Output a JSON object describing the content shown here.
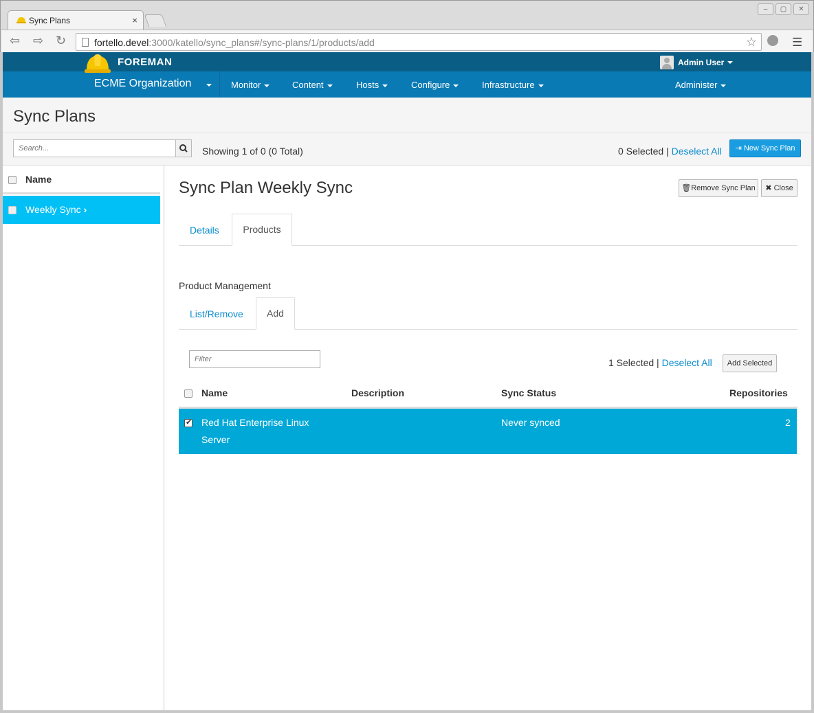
{
  "browser": {
    "tab_title": "Sync Plans",
    "tab_close": "×",
    "url_host": "fortello.devel",
    "url_rest": ":3000/katello/sync_plans#/sync-plans/1/products/add",
    "window_buttons": [
      "–",
      "▢",
      "✕"
    ]
  },
  "header": {
    "brand": "FOREMAN",
    "user": "Admin User",
    "organization": "ECME Organization",
    "nav": [
      "Monitor",
      "Content",
      "Hosts",
      "Configure",
      "Infrastructure"
    ],
    "administer": "Administer",
    "accent": "#0a7ab4"
  },
  "page": {
    "title": "Sync Plans",
    "search_placeholder": "Search...",
    "showing": "Showing 1 of 0 (0 Total)",
    "selected_text": "0 Selected |",
    "deselect_all": "Deselect All",
    "new_button": "New Sync Plan"
  },
  "list": {
    "header": "Name",
    "rows": [
      {
        "label": "Weekly Sync"
      }
    ]
  },
  "detail": {
    "title": "Sync Plan Weekly Sync",
    "remove_button": "Remove Sync Plan",
    "close_button": "Close",
    "tabs": [
      "Details",
      "Products"
    ],
    "section_label": "Product Management",
    "subtabs": [
      "List/Remove",
      "Add"
    ],
    "filter_placeholder": "Filter",
    "selected_text": "1 Selected |",
    "deselect_all": "Deselect All",
    "add_selected": "Add Selected",
    "columns": [
      "Name",
      "Description",
      "Sync Status",
      "Repositories"
    ],
    "rows": [
      {
        "name_line1": "Red Hat Enterprise Linux",
        "name_line2": "Server",
        "description": "",
        "sync_status": "Never synced",
        "repositories": "2",
        "checked": true
      }
    ]
  }
}
